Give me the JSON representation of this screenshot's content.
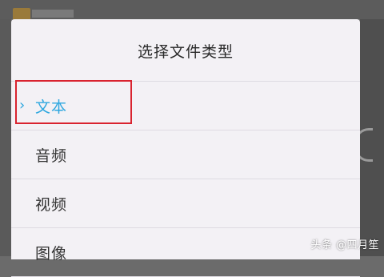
{
  "dialog": {
    "title": "选择文件类型",
    "selected_index": 0,
    "options": [
      {
        "label": "文本",
        "selected": true
      },
      {
        "label": "音频",
        "selected": false
      },
      {
        "label": "视频",
        "selected": false
      },
      {
        "label": "图像",
        "selected": false
      }
    ]
  },
  "overlay": {
    "highlight_color": "#d9232f",
    "highlighted_option": "文本"
  },
  "colors": {
    "accent": "#2ea7df",
    "dialog_bg": "#f3f1f5",
    "text": "#333333"
  },
  "icons": {
    "selected_marker": "chevron-right-icon"
  },
  "watermark": {
    "text": "头条 @四月笙"
  }
}
